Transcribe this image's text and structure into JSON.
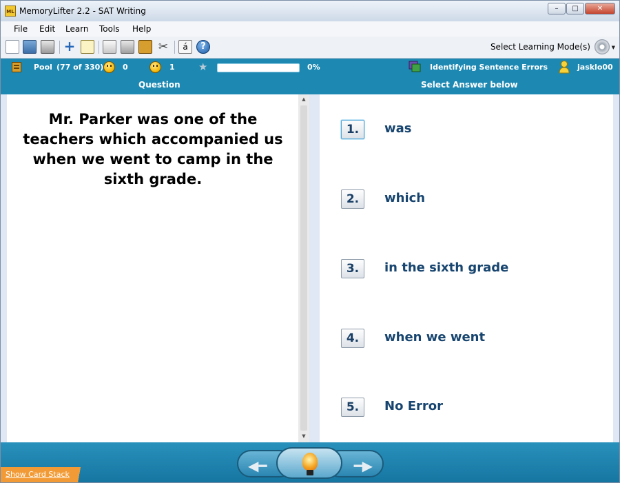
{
  "window": {
    "title": "MemoryLifter 2.2 - SAT Writing",
    "app_icon_text": "ML",
    "minimize": "–",
    "maximize": "□",
    "close": "✕"
  },
  "menu": [
    "File",
    "Edit",
    "Learn",
    "Tools",
    "Help"
  ],
  "toolbar": {
    "icons": [
      "new-file-icon",
      "open-folder-icon",
      "print-icon",
      "add-icon",
      "edit-icon",
      "presentation-icon",
      "print-cards-icon",
      "box-icon",
      "tools-icon",
      "special-char-icon",
      "help-icon"
    ],
    "special_char": "á",
    "help_char": "?",
    "mode_label": "Select Learning Mode(s)"
  },
  "stats": {
    "pool_label": "Pool",
    "pool_count": "(77 of 330)",
    "happy_count": "0",
    "sad_count": "1",
    "progress_percent": "0%",
    "progress_value": 0,
    "chapter": "Identifying Sentence Errors",
    "user": "jasklo00"
  },
  "headers": {
    "question": "Question",
    "answer": "Select Answer below"
  },
  "question": "Mr. Parker was one of the teachers which accompanied us when we went to camp in the sixth grade.",
  "answers": [
    {
      "num": "1.",
      "text": "was"
    },
    {
      "num": "2.",
      "text": "which"
    },
    {
      "num": "3.",
      "text": "in the sixth grade"
    },
    {
      "num": "4.",
      "text": "when we went"
    },
    {
      "num": "5.",
      "text": "No Error"
    }
  ],
  "footer": {
    "show_card_stack": "Show Card Stack"
  },
  "colors": {
    "accent": "#1d89b3",
    "answer_text": "#17456f",
    "card_stack": "#f29b36"
  }
}
